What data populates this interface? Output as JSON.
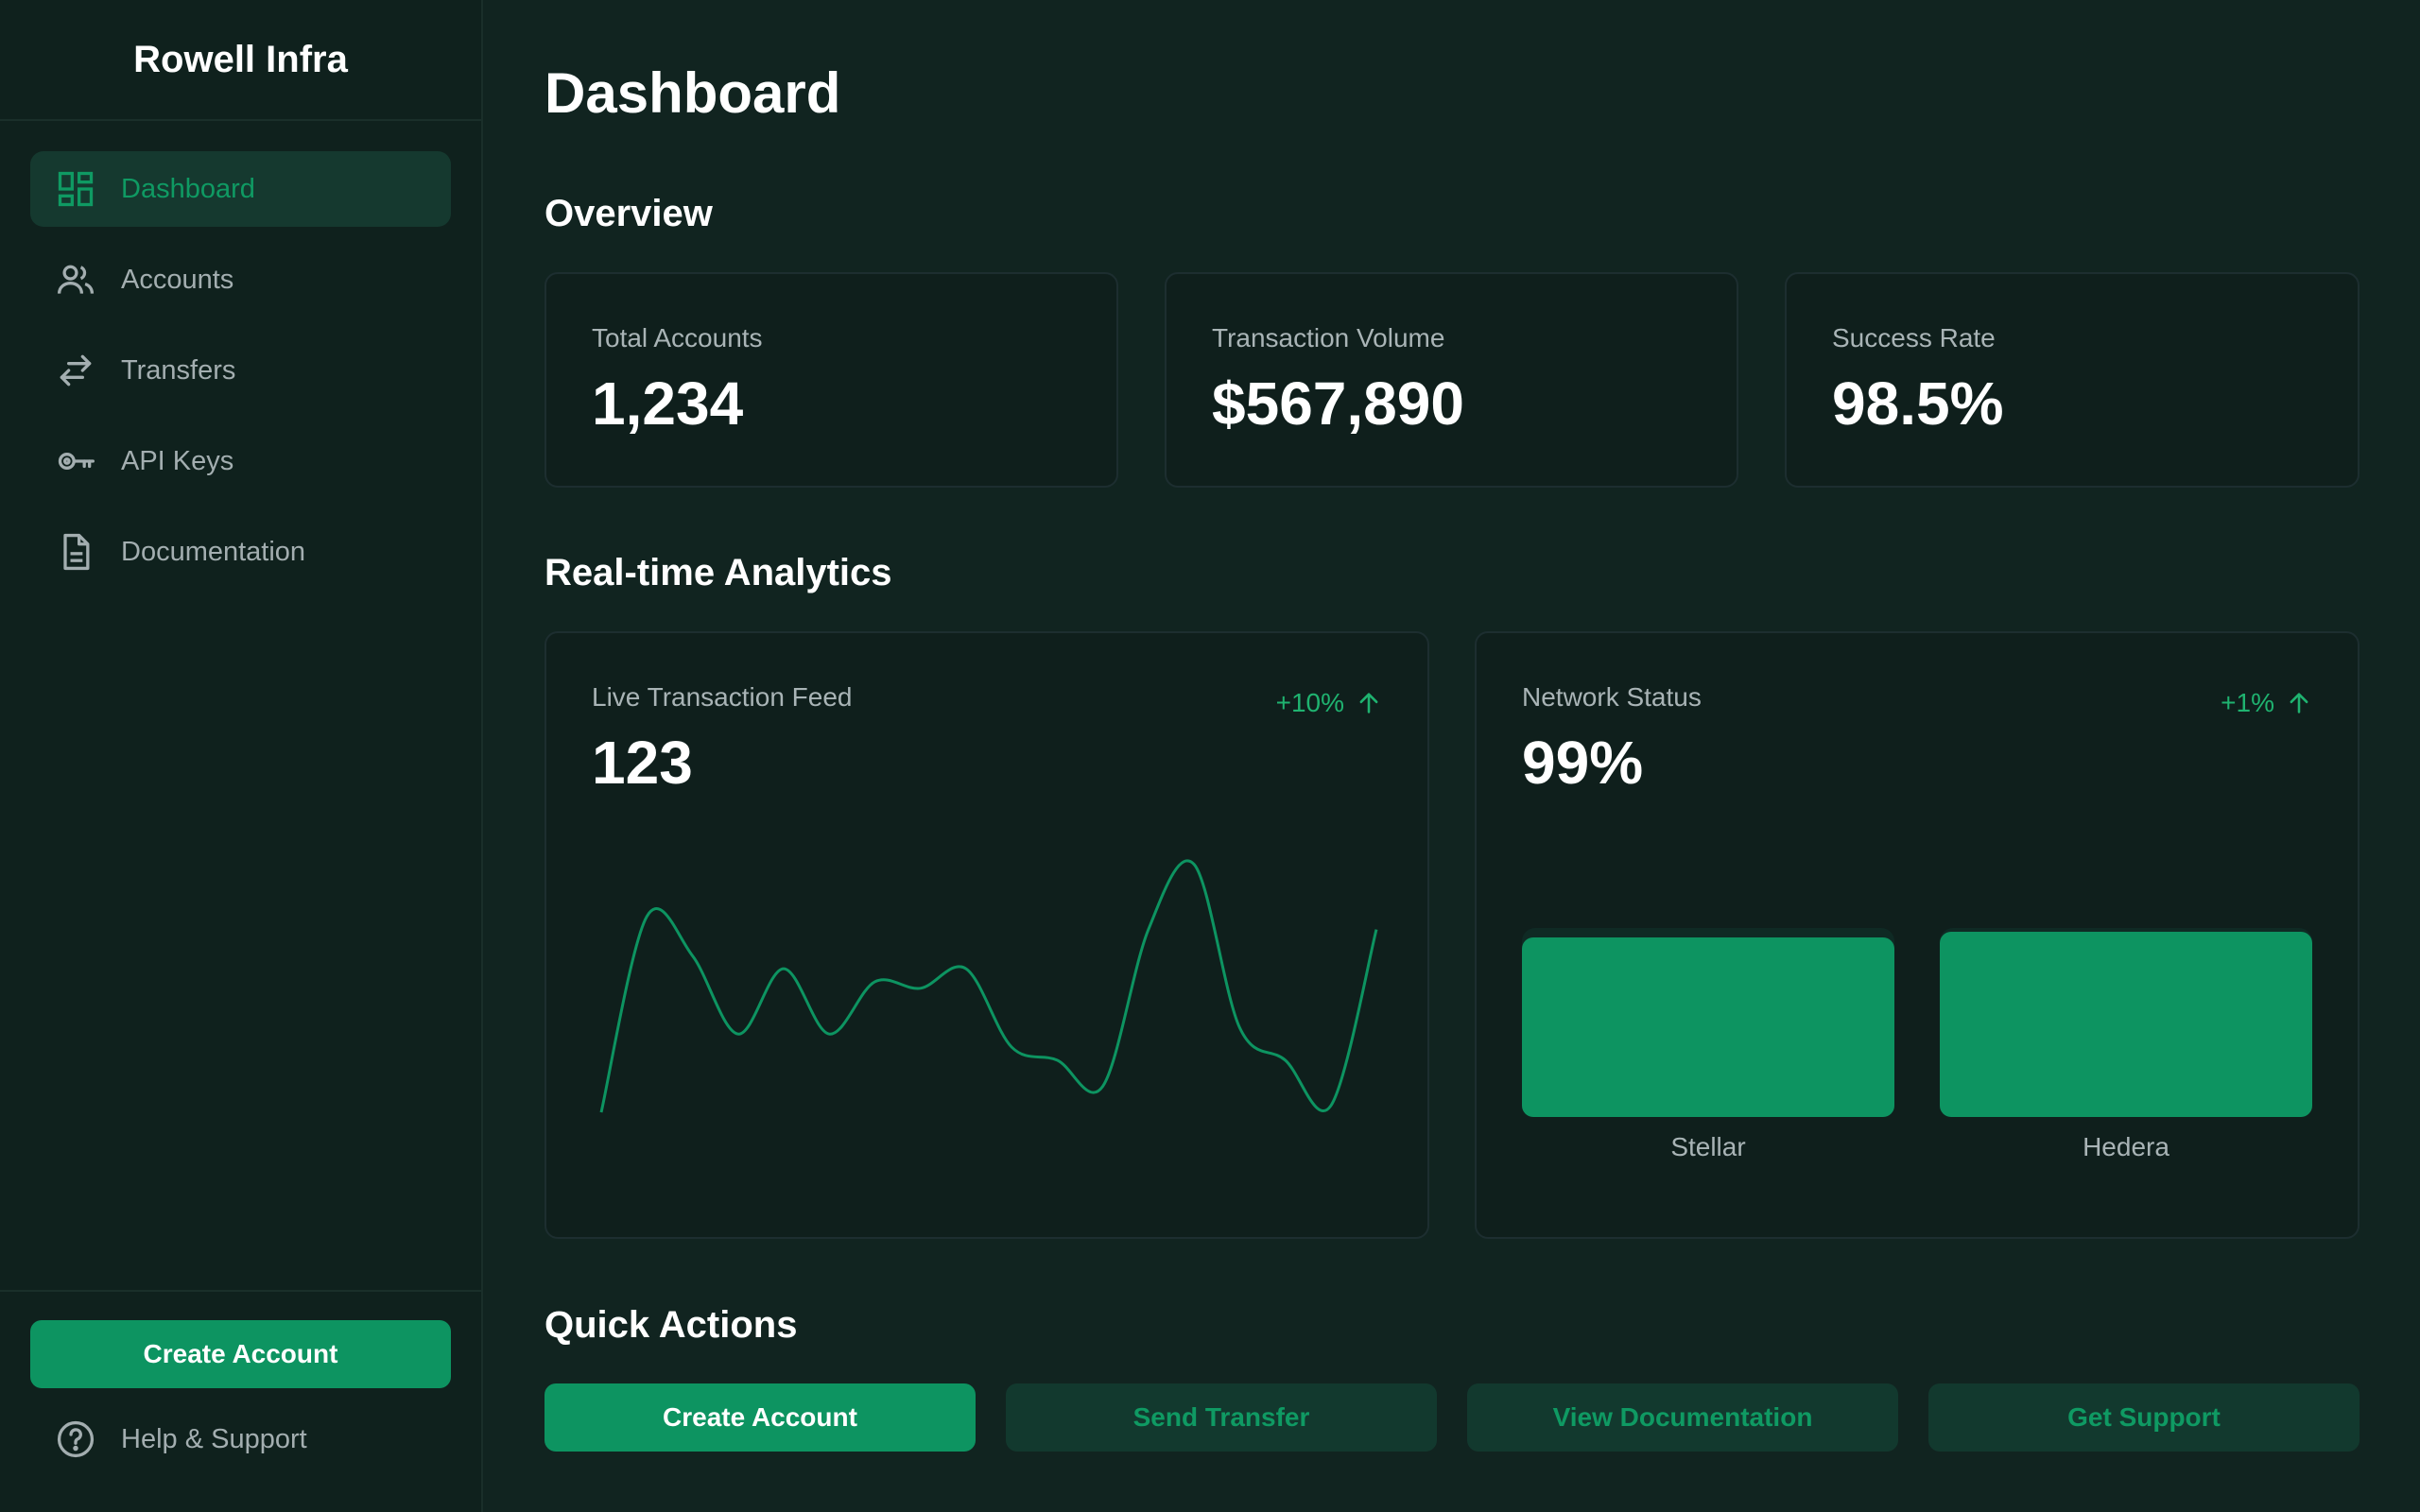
{
  "brand": "Rowell Infra",
  "sidebar": {
    "items": [
      {
        "label": "Dashboard",
        "icon": "dashboard-icon",
        "active": true
      },
      {
        "label": "Accounts",
        "icon": "users-icon",
        "active": false
      },
      {
        "label": "Transfers",
        "icon": "transfer-arrows-icon",
        "active": false
      },
      {
        "label": "API Keys",
        "icon": "key-icon",
        "active": false
      },
      {
        "label": "Documentation",
        "icon": "document-icon",
        "active": false
      }
    ],
    "create_account_label": "Create Account",
    "help_label": "Help & Support"
  },
  "main": {
    "title": "Dashboard",
    "overview_title": "Overview",
    "stats": [
      {
        "label": "Total Accounts",
        "value": "1,234"
      },
      {
        "label": "Transaction Volume",
        "value": "$567,890"
      },
      {
        "label": "Success Rate",
        "value": "98.5%"
      }
    ],
    "analytics_title": "Real-time Analytics",
    "live_feed": {
      "label": "Live Transaction Feed",
      "value": "123",
      "trend": "+10%"
    },
    "network": {
      "label": "Network Status",
      "value": "99%",
      "trend": "+1%"
    },
    "quick_actions_title": "Quick Actions",
    "quick_actions": [
      "Create Account",
      "Send Transfer",
      "View Documentation",
      "Get Support"
    ]
  },
  "colors": {
    "background": "#112420",
    "sidebar": "#0f211d",
    "accent": "#0d9461",
    "trend_up": "#1fb370"
  },
  "chart_data": [
    {
      "type": "line",
      "x": [
        0,
        1,
        2,
        3,
        4,
        5,
        6,
        7,
        8,
        9,
        10,
        11,
        12,
        13,
        14,
        15,
        16,
        17
      ],
      "values": [
        62,
        92,
        86,
        74,
        84,
        74,
        82,
        81,
        84,
        72,
        70,
        66,
        90,
        100,
        75,
        70,
        63,
        90
      ],
      "ylim": [
        0,
        100
      ]
    },
    {
      "type": "bar",
      "categories": [
        "Stellar",
        "Hedera"
      ],
      "values": [
        95,
        98
      ],
      "ylim": [
        0,
        100
      ]
    }
  ]
}
